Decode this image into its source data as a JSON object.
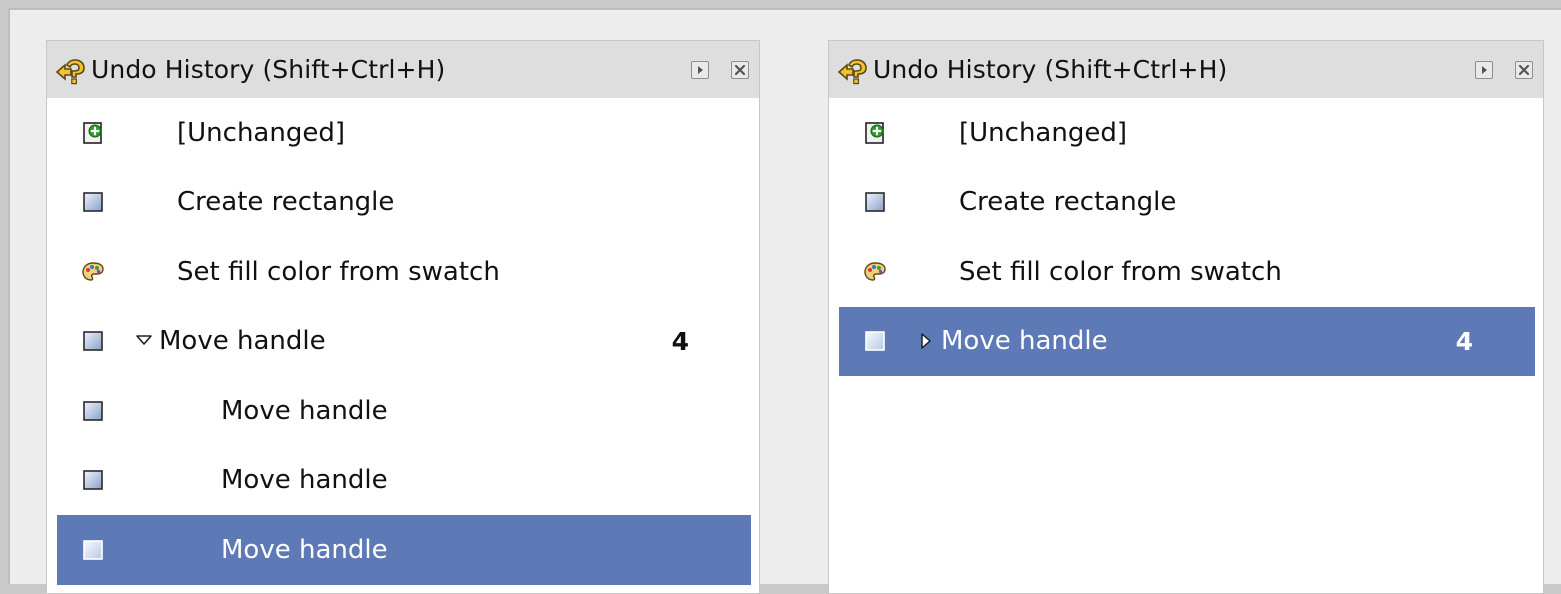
{
  "left_panel": {
    "title": "Undo History (Shift+Ctrl+H)",
    "icons": {
      "title": "undo-history-icon",
      "buttons": [
        "expand-panel-icon",
        "close-panel-icon"
      ]
    },
    "items": [
      {
        "label": "[Unchanged]",
        "icon": "document-new-icon",
        "level": 0,
        "toggle": null,
        "count": null,
        "selected": false
      },
      {
        "label": "Create rectangle",
        "icon": "rectangle-icon",
        "level": 0,
        "toggle": null,
        "count": null,
        "selected": false
      },
      {
        "label": "Set fill color from swatch",
        "icon": "palette-icon",
        "level": 0,
        "toggle": null,
        "count": null,
        "selected": false
      },
      {
        "label": "Move handle",
        "icon": "rectangle-icon",
        "level": 0,
        "toggle": "expanded",
        "count": "4",
        "selected": false
      },
      {
        "label": "Move handle",
        "icon": "rectangle-icon",
        "level": 1,
        "toggle": null,
        "count": null,
        "selected": false
      },
      {
        "label": "Move handle",
        "icon": "rectangle-icon",
        "level": 1,
        "toggle": null,
        "count": null,
        "selected": false
      },
      {
        "label": "Move handle",
        "icon": "rectangle-icon",
        "level": 1,
        "toggle": null,
        "count": null,
        "selected": true
      }
    ]
  },
  "right_panel": {
    "title": "Undo History (Shift+Ctrl+H)",
    "icons": {
      "title": "undo-history-icon",
      "buttons": [
        "expand-panel-icon",
        "close-panel-icon"
      ]
    },
    "items": [
      {
        "label": "[Unchanged]",
        "icon": "document-new-icon",
        "level": 0,
        "toggle": null,
        "count": null,
        "selected": false
      },
      {
        "label": "Create rectangle",
        "icon": "rectangle-icon",
        "level": 0,
        "toggle": null,
        "count": null,
        "selected": false
      },
      {
        "label": "Set fill color from swatch",
        "icon": "palette-icon",
        "level": 0,
        "toggle": null,
        "count": null,
        "selected": false
      },
      {
        "label": "Move handle",
        "icon": "rectangle-icon",
        "level": 0,
        "toggle": "collapsed",
        "count": "4",
        "selected": true
      }
    ]
  },
  "colors": {
    "selection_bg": "#5d79b6",
    "selection_text": "#ffffff",
    "panel_bg": "#ffffff",
    "titlebar_bg": "#dedede",
    "window_bg": "#ededed"
  }
}
